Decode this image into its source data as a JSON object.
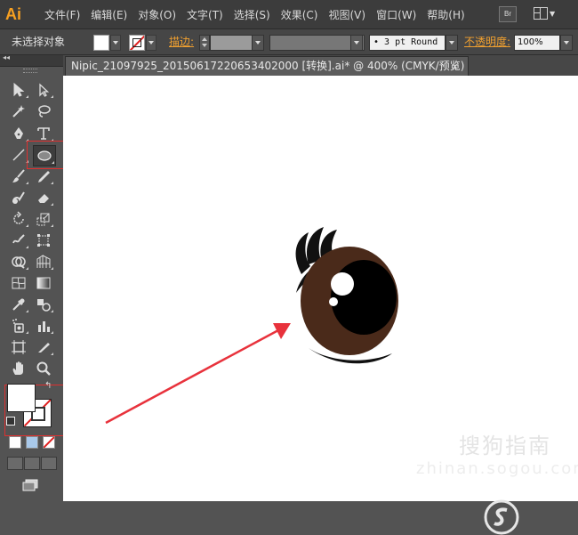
{
  "app": {
    "logo": "Ai",
    "bridge_label": "Br"
  },
  "menu": [
    "文件(F)",
    "编辑(E)",
    "对象(O)",
    "文字(T)",
    "选择(S)",
    "效果(C)",
    "视图(V)",
    "窗口(W)",
    "帮助(H)"
  ],
  "control_bar": {
    "selection_status": "未选择对象",
    "stroke_label": "描边:",
    "brush_value": "• 3 pt Round",
    "opacity_label": "不透明度:",
    "opacity_value": "100%"
  },
  "document_tab": {
    "title": "Nipic_21097925_20150617220653402000 [转换].ai* @ 400% (CMYK/预览)",
    "close_glyph": "×"
  },
  "tools": [
    "selection-tool",
    "direct-selection-tool",
    "magic-wand-tool",
    "lasso-tool",
    "pen-tool",
    "type-tool",
    "line-tool",
    "ellipse-tool",
    "paintbrush-tool",
    "pencil-tool",
    "blob-brush-tool",
    "eraser-tool",
    "rotate-tool",
    "scale-tool",
    "warp-tool",
    "free-transform-tool",
    "shape-builder-tool",
    "perspective-grid-tool",
    "mesh-tool",
    "gradient-tool",
    "eyedropper-tool",
    "blend-tool",
    "symbol-sprayer-tool",
    "column-graph-tool",
    "artboard-tool",
    "slice-tool",
    "hand-tool",
    "zoom-tool"
  ],
  "highlighted_tool": "ellipse-tool",
  "colors": {
    "fill": "#ffffff",
    "stroke": "none",
    "highlight_box": "#e03030",
    "arrow": "#e8323c",
    "eye_iris": "#4a2a1a",
    "eye_white": "#d8e8f4"
  },
  "watermark": {
    "brand": "搜狗指南",
    "url": "zhinan.sogou.com"
  }
}
